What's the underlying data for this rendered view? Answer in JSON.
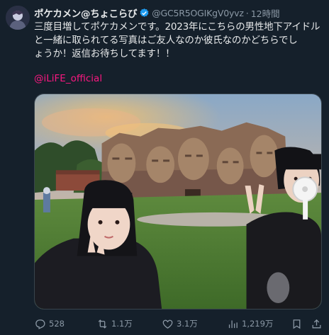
{
  "tweet": {
    "display_name": "ポケカメン@ちょこらび",
    "handle": "@GC5R5OGIKgV0yvz",
    "separator": "·",
    "time": "12時間",
    "text_lines": [
      "三度目増してポケカメンです。2023年にこちらの男性地下アイドル",
      "と一緒に取られてる写真はご友人なのか彼氏なのかどちらでし",
      "ょうか！返信お待ちしてます！！"
    ],
    "mention": "@iLiFE_official"
  },
  "actions": {
    "replies": "528",
    "retweets": "1.1万",
    "likes": "3.1万",
    "views": "1,219万"
  },
  "colors": {
    "background": "#15202b",
    "text": "#e7e9ea",
    "muted": "#8b98a5",
    "mention": "#f91880",
    "verified": "#1d9bf0"
  },
  "icons": [
    "avatar",
    "verified-badge-icon",
    "reply-icon",
    "retweet-icon",
    "like-icon",
    "views-icon",
    "bookmark-icon",
    "share-icon"
  ]
}
